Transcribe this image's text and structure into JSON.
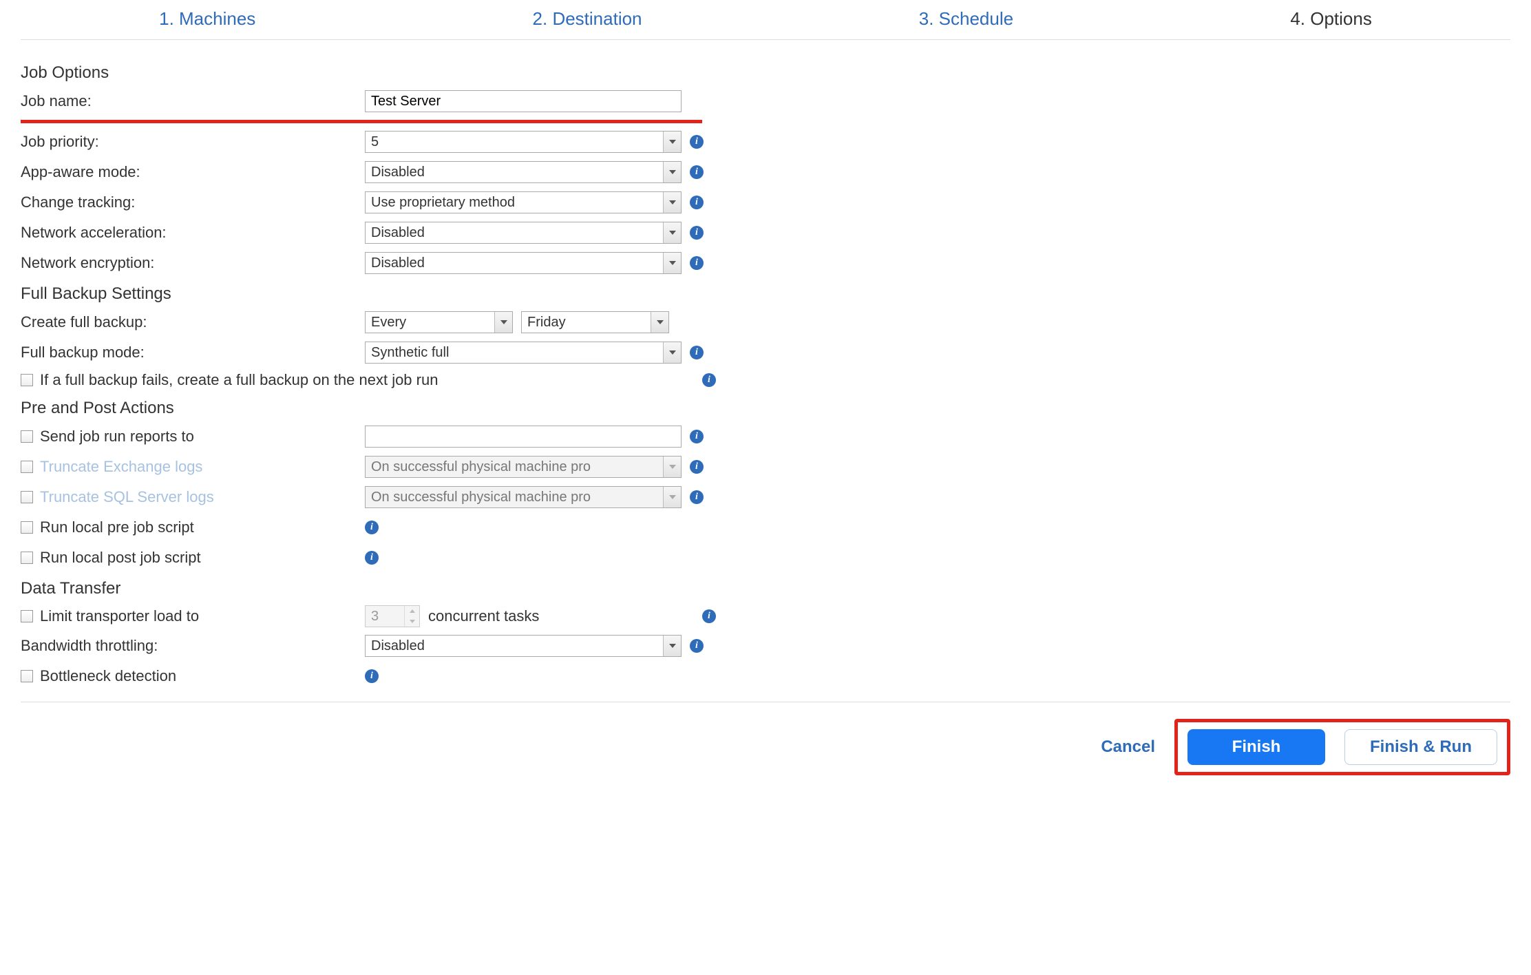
{
  "steps": {
    "s1": "1. Machines",
    "s2": "2. Destination",
    "s3": "3. Schedule",
    "s4": "4. Options"
  },
  "sections": {
    "job_options": {
      "title": "Job Options",
      "job_name_label": "Job name:",
      "job_name_value": "Test Server",
      "job_priority_label": "Job priority:",
      "job_priority_value": "5",
      "app_aware_label": "App-aware mode:",
      "app_aware_value": "Disabled",
      "change_tracking_label": "Change tracking:",
      "change_tracking_value": "Use proprietary method",
      "net_accel_label": "Network acceleration:",
      "net_accel_value": "Disabled",
      "net_enc_label": "Network encryption:",
      "net_enc_value": "Disabled"
    },
    "full_backup": {
      "title": "Full Backup Settings",
      "create_label": "Create full backup:",
      "create_freq": "Every",
      "create_day": "Friday",
      "mode_label": "Full backup mode:",
      "mode_value": "Synthetic full",
      "fail_checkbox": "If a full backup fails, create a full backup on the next job run"
    },
    "pre_post": {
      "title": "Pre and Post Actions",
      "send_reports_label": "Send job run reports to",
      "send_reports_value": "",
      "truncate_exchange_label": "Truncate Exchange logs",
      "truncate_exchange_value": "On successful physical machine pro",
      "truncate_sql_label": "Truncate SQL Server logs",
      "truncate_sql_value": "On successful physical machine pro",
      "pre_script_label": "Run local pre job script",
      "post_script_label": "Run local post job script"
    },
    "data_transfer": {
      "title": "Data Transfer",
      "limit_label": "Limit transporter load to",
      "limit_value": "3",
      "limit_suffix": "concurrent tasks",
      "bandwidth_label": "Bandwidth throttling:",
      "bandwidth_value": "Disabled",
      "bottleneck_label": "Bottleneck detection"
    }
  },
  "footer": {
    "cancel": "Cancel",
    "finish": "Finish",
    "finish_run": "Finish & Run"
  }
}
